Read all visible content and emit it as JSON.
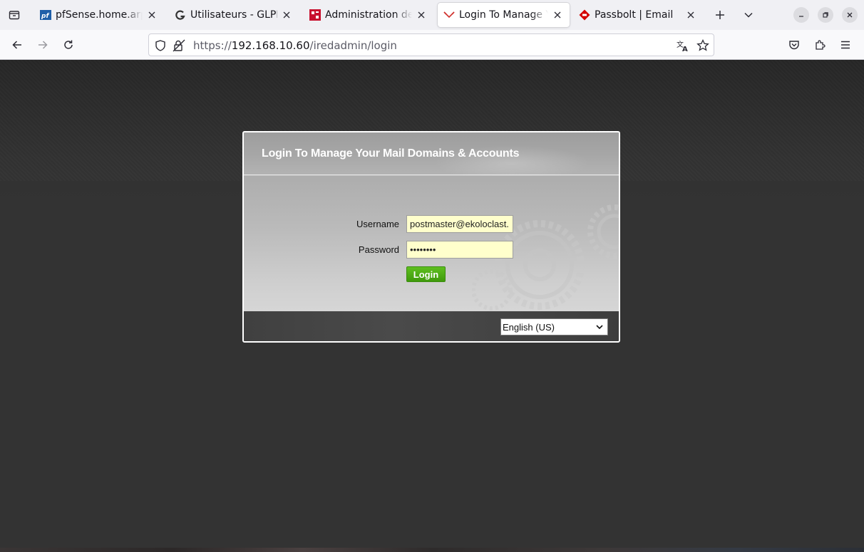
{
  "browser": {
    "tabs": [
      {
        "title": "pfSense.home.arpa",
        "favicon": "pfsense-icon",
        "active": false
      },
      {
        "title": "Utilisateurs - GLPI",
        "favicon": "glpi-icon",
        "active": false
      },
      {
        "title": "Administration de s",
        "favicon": "admin-icon",
        "active": false
      },
      {
        "title": "Login To Manage Yo",
        "favicon": "iredmail-icon",
        "active": true
      },
      {
        "title": "Passbolt | Email",
        "favicon": "passbolt-icon",
        "active": false
      }
    ],
    "url": {
      "scheme": "https://",
      "host": "192.168.10.60",
      "path": "/iredadmin/login"
    },
    "colors": {
      "active_tab": "#ffffff",
      "strip": "#f0f0f4"
    }
  },
  "login": {
    "title": "Login To Manage Your Mail Domains & Accounts",
    "username_label": "Username",
    "username_value": "postmaster@ekoloclast.",
    "password_label": "Password",
    "password_mask": "••••••••",
    "login_button": "Login",
    "language_selected": "English (US)",
    "colors": {
      "button": "#4aa814",
      "input_bg": "#ffffcc",
      "page_bg": "#333333"
    }
  }
}
